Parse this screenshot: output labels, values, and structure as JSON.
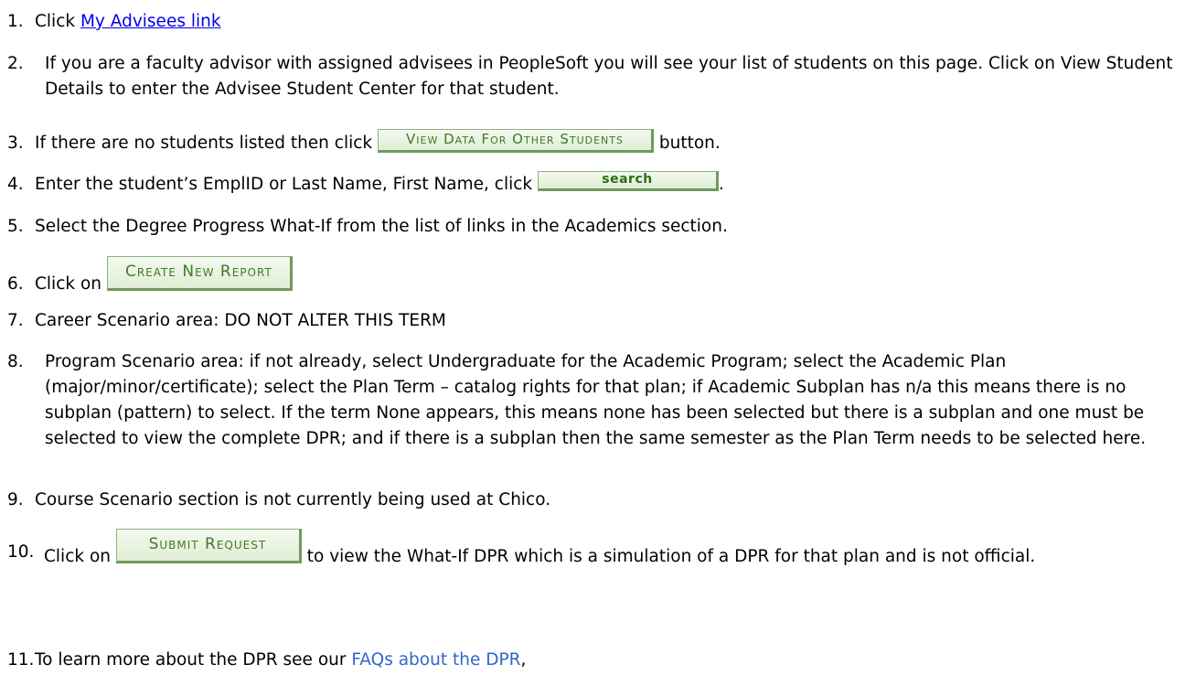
{
  "steps": [
    {
      "num": "1.",
      "text_before": "Click ",
      "link": "My Advisees link"
    },
    {
      "num": "2.",
      "text": "If you are a faculty advisor with assigned advisees in PeopleSoft you will see your list of students on this page. Click on View Student Details to enter the Advisee Student Center for that student."
    },
    {
      "num": "3.",
      "text_before": "If there are no students listed then click ",
      "button": "View Data For Other Students",
      "text_after": " button."
    },
    {
      "num": "4.",
      "text_before": "Enter the student’s EmplID  or Last Name, First Name, click ",
      "button": "search",
      "text_after": "."
    },
    {
      "num": "5.",
      "text": "Select the Degree Progress What-If from the list of links in the Academics section."
    },
    {
      "num": "6.",
      "text_before": "Click on ",
      "button": "Create New Report"
    },
    {
      "num": "7.",
      "text": "Career Scenario area: DO NOT ALTER THIS TERM"
    },
    {
      "num": "8.",
      "text": "Program Scenario area: if not already, select Undergraduate for the Academic Program; select the Academic Plan (major/minor/certificate); select the Plan Term – catalog rights for that plan; if Academic Subplan has n/a this means there is no subplan (pattern) to select. If the term  None appears, this means none has been selected but there is a subplan and one must be selected to view the complete DPR; and if there is a subplan then the same semester as the Plan Term needs to be selected here."
    },
    {
      "num": "9.",
      "text": "Course Scenario section is not currently being used at Chico."
    },
    {
      "num": "10.",
      "text_before": "Click on ",
      "button": "Submit Request",
      "text_after": " to view the What-If DPR which is a simulation of a DPR for that plan and is not official."
    },
    {
      "num": "11.",
      "text_before": "To learn more about the DPR see our ",
      "link": "FAQs about the DPR",
      "text_after": ","
    }
  ],
  "colors": {
    "link_underlined": "#0000ee",
    "link_plain": "#3366cc",
    "button_text": "#3f7a2a",
    "button_border": "#6f9a5c"
  }
}
